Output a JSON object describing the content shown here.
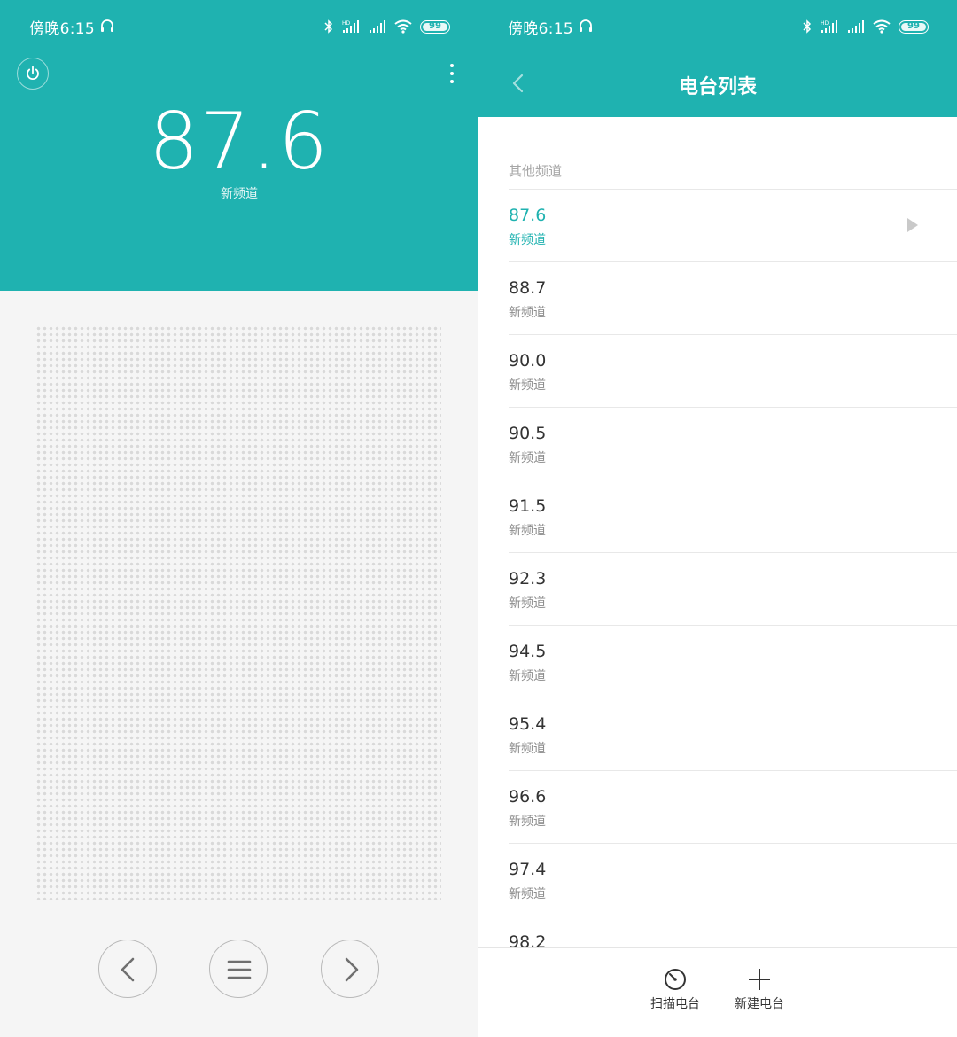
{
  "colors": {
    "accent": "#1fb2b0",
    "background": "#f5f5f5",
    "divider": "#e8e8e8"
  },
  "status_bar": {
    "time": "傍晚6:15",
    "battery": "99",
    "network": "HD"
  },
  "player": {
    "frequency": "87.6",
    "station_name": "新频道",
    "icons": [
      "power-icon",
      "more-icon",
      "previous-icon",
      "menu-icon",
      "next-icon"
    ]
  },
  "station_list": {
    "title": "电台列表",
    "section_label": "其他频道",
    "stations": [
      {
        "frequency": "87.6",
        "name": "新频道",
        "playing": true
      },
      {
        "frequency": "88.7",
        "name": "新频道"
      },
      {
        "frequency": "90.0",
        "name": "新频道"
      },
      {
        "frequency": "90.5",
        "name": "新频道"
      },
      {
        "frequency": "91.5",
        "name": "新频道"
      },
      {
        "frequency": "92.3",
        "name": "新频道"
      },
      {
        "frequency": "94.5",
        "name": "新频道"
      },
      {
        "frequency": "95.4",
        "name": "新频道"
      },
      {
        "frequency": "96.6",
        "name": "新频道"
      },
      {
        "frequency": "97.4",
        "name": "新频道"
      },
      {
        "frequency": "98.2",
        "name": ""
      }
    ],
    "actions": {
      "scan_label": "扫描电台",
      "add_label": "新建电台"
    }
  }
}
